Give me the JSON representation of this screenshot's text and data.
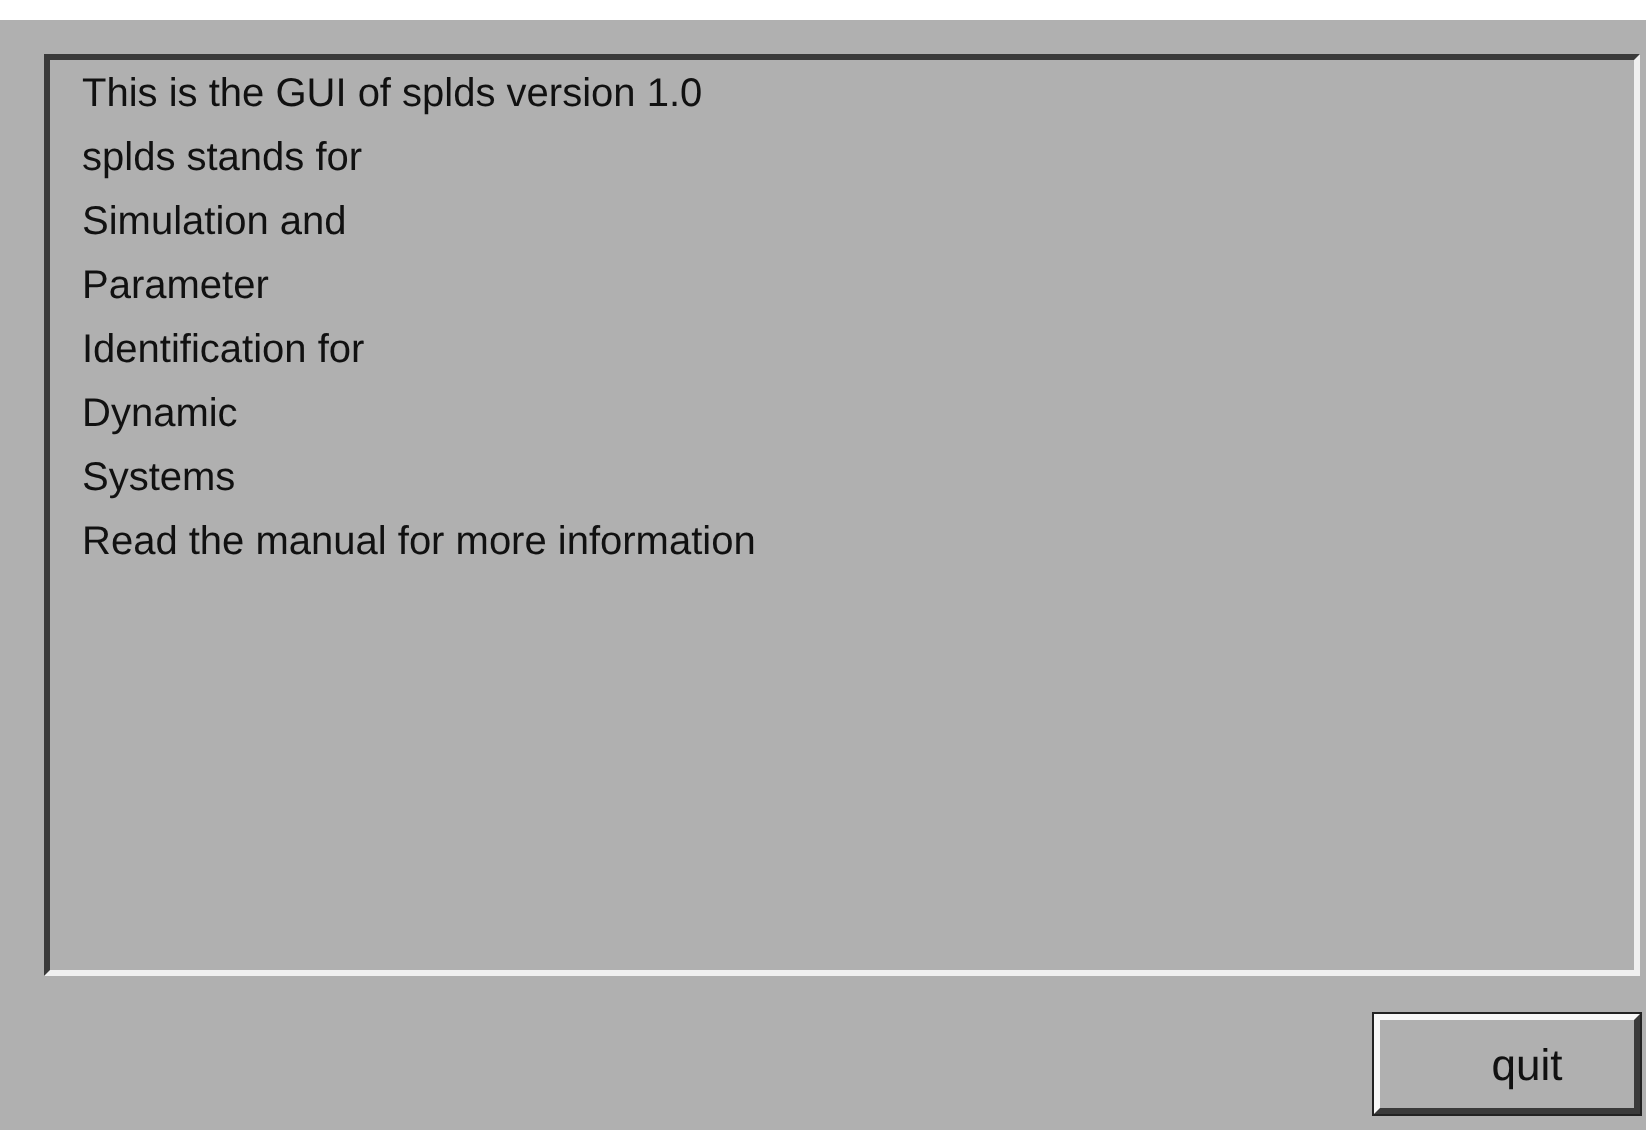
{
  "text_area": {
    "lines": [
      "This is the GUI of splds version 1.0",
      "splds stands for",
      "Simulation and",
      "Parameter",
      "Identification for",
      "Dynamic",
      "Systems",
      "Read the manual for more information"
    ]
  },
  "buttons": [
    {
      "label": "quit"
    }
  ]
}
